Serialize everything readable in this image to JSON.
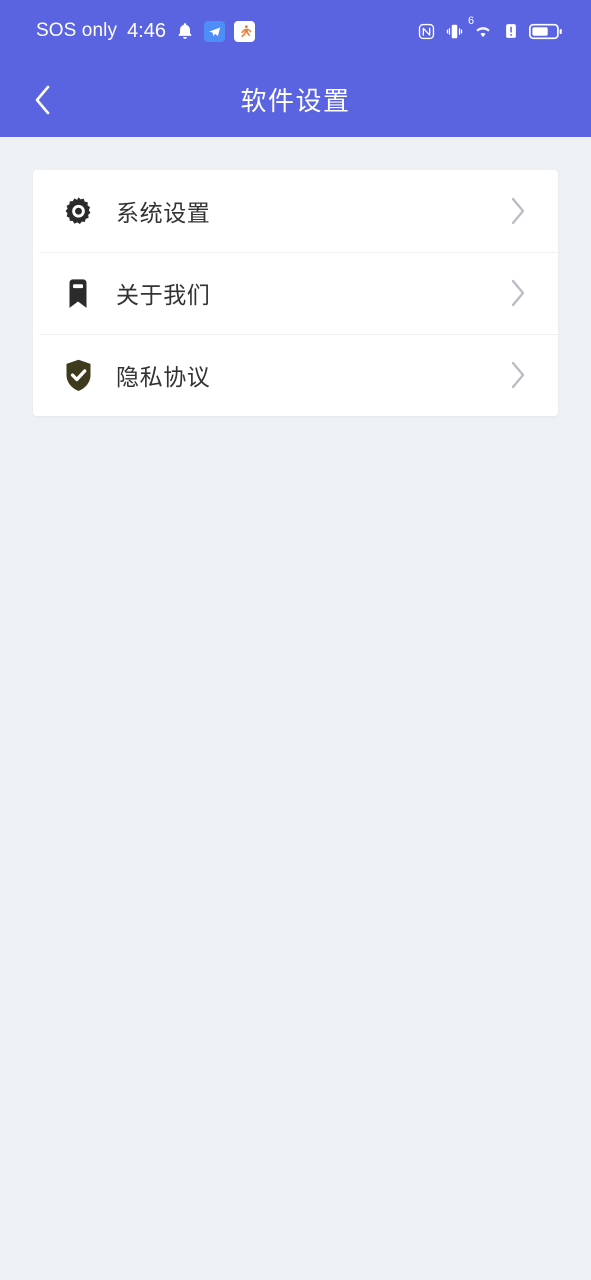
{
  "status_bar": {
    "carrier": "SOS only",
    "time": "4:46",
    "left_icons": [
      {
        "name": "bell-icon",
        "label": "notification-bell"
      },
      {
        "name": "app-notification-blue-icon",
        "label": "app-badge-blue"
      },
      {
        "name": "app-notification-runner-icon",
        "label": "app-badge-runner"
      }
    ],
    "right_icons": [
      {
        "name": "nfc-icon",
        "label": "NFC"
      },
      {
        "name": "vibrate-icon",
        "label": "vibrate-mode"
      },
      {
        "name": "wifi-icon",
        "label": "wifi",
        "generation": "6"
      },
      {
        "name": "alert-icon",
        "label": "alert"
      },
      {
        "name": "battery-icon",
        "label": "battery",
        "level_percent": 60
      }
    ]
  },
  "app_bar": {
    "back_label": "返回",
    "title": "软件设置"
  },
  "settings": {
    "items": [
      {
        "icon": "gear-icon",
        "label": "系统设置",
        "chevron": "chevron-right-icon"
      },
      {
        "icon": "bookmark-icon",
        "label": "关于我们",
        "chevron": "chevron-right-icon"
      },
      {
        "icon": "shield-check-icon",
        "label": "隐私协议",
        "chevron": "chevron-right-icon"
      }
    ]
  },
  "colors": {
    "header_blue": "#5a63e0",
    "page_background": "#edf1f4",
    "card_white": "#ffffff",
    "label_text": "#333333",
    "chevron_gray": "#b8bcc4",
    "icon_dark": "#2b2b2b",
    "shield_olive": "#3d3a1e"
  }
}
